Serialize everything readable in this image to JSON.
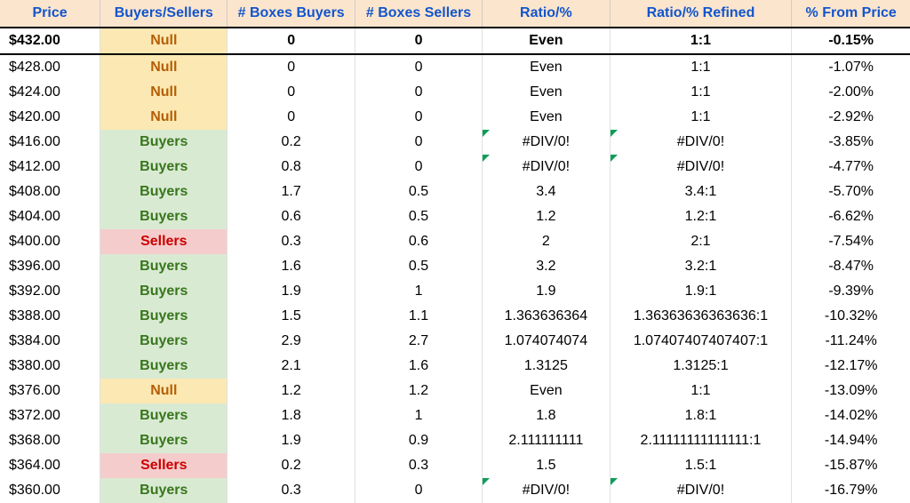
{
  "headers": {
    "price": "Price",
    "bs": "Buyers/Sellers",
    "bb": "# Boxes Buyers",
    "sb": "# Boxes Sellers",
    "ratio": "Ratio/%",
    "ratio_refined": "Ratio/% Refined",
    "from_price": "% From Price"
  },
  "rows": [
    {
      "price": "$432.00",
      "bs": "Null",
      "bb": "0",
      "sb": "0",
      "ratio": "Even",
      "ratio_refined": "1:1",
      "from_price": "-0.15%",
      "bold": true
    },
    {
      "price": "$428.00",
      "bs": "Null",
      "bb": "0",
      "sb": "0",
      "ratio": "Even",
      "ratio_refined": "1:1",
      "from_price": "-1.07%"
    },
    {
      "price": "$424.00",
      "bs": "Null",
      "bb": "0",
      "sb": "0",
      "ratio": "Even",
      "ratio_refined": "1:1",
      "from_price": "-2.00%"
    },
    {
      "price": "$420.00",
      "bs": "Null",
      "bb": "0",
      "sb": "0",
      "ratio": "Even",
      "ratio_refined": "1:1",
      "from_price": "-2.92%"
    },
    {
      "price": "$416.00",
      "bs": "Buyers",
      "bb": "0.2",
      "sb": "0",
      "ratio": "#DIV/0!",
      "ratio_refined": "#DIV/0!",
      "from_price": "-3.85%",
      "err": true
    },
    {
      "price": "$412.00",
      "bs": "Buyers",
      "bb": "0.8",
      "sb": "0",
      "ratio": "#DIV/0!",
      "ratio_refined": "#DIV/0!",
      "from_price": "-4.77%",
      "err": true
    },
    {
      "price": "$408.00",
      "bs": "Buyers",
      "bb": "1.7",
      "sb": "0.5",
      "ratio": "3.4",
      "ratio_refined": "3.4:1",
      "from_price": "-5.70%"
    },
    {
      "price": "$404.00",
      "bs": "Buyers",
      "bb": "0.6",
      "sb": "0.5",
      "ratio": "1.2",
      "ratio_refined": "1.2:1",
      "from_price": "-6.62%"
    },
    {
      "price": "$400.00",
      "bs": "Sellers",
      "bb": "0.3",
      "sb": "0.6",
      "ratio": "2",
      "ratio_refined": "2:1",
      "from_price": "-7.54%"
    },
    {
      "price": "$396.00",
      "bs": "Buyers",
      "bb": "1.6",
      "sb": "0.5",
      "ratio": "3.2",
      "ratio_refined": "3.2:1",
      "from_price": "-8.47%"
    },
    {
      "price": "$392.00",
      "bs": "Buyers",
      "bb": "1.9",
      "sb": "1",
      "ratio": "1.9",
      "ratio_refined": "1.9:1",
      "from_price": "-9.39%"
    },
    {
      "price": "$388.00",
      "bs": "Buyers",
      "bb": "1.5",
      "sb": "1.1",
      "ratio": "1.363636364",
      "ratio_refined": "1.36363636363636:1",
      "from_price": "-10.32%"
    },
    {
      "price": "$384.00",
      "bs": "Buyers",
      "bb": "2.9",
      "sb": "2.7",
      "ratio": "1.074074074",
      "ratio_refined": "1.07407407407407:1",
      "from_price": "-11.24%"
    },
    {
      "price": "$380.00",
      "bs": "Buyers",
      "bb": "2.1",
      "sb": "1.6",
      "ratio": "1.3125",
      "ratio_refined": "1.3125:1",
      "from_price": "-12.17%"
    },
    {
      "price": "$376.00",
      "bs": "Null",
      "bb": "1.2",
      "sb": "1.2",
      "ratio": "Even",
      "ratio_refined": "1:1",
      "from_price": "-13.09%"
    },
    {
      "price": "$372.00",
      "bs": "Buyers",
      "bb": "1.8",
      "sb": "1",
      "ratio": "1.8",
      "ratio_refined": "1.8:1",
      "from_price": "-14.02%"
    },
    {
      "price": "$368.00",
      "bs": "Buyers",
      "bb": "1.9",
      "sb": "0.9",
      "ratio": "2.111111111",
      "ratio_refined": "2.11111111111111:1",
      "from_price": "-14.94%"
    },
    {
      "price": "$364.00",
      "bs": "Sellers",
      "bb": "0.2",
      "sb": "0.3",
      "ratio": "1.5",
      "ratio_refined": "1.5:1",
      "from_price": "-15.87%"
    },
    {
      "price": "$360.00",
      "bs": "Buyers",
      "bb": "0.3",
      "sb": "0",
      "ratio": "#DIV/0!",
      "ratio_refined": "#DIV/0!",
      "from_price": "-16.79%",
      "err": true
    }
  ]
}
